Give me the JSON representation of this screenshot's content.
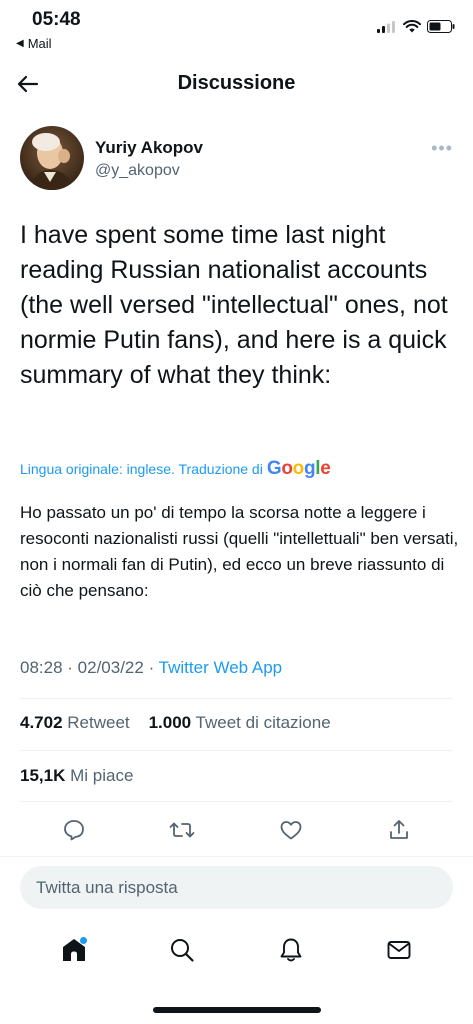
{
  "status_bar": {
    "time": "05:48",
    "back_label": "Mail",
    "icons": [
      "cellular-signal-icon",
      "wifi-icon",
      "battery-icon"
    ]
  },
  "header": {
    "title": "Discussione",
    "back_icon": "arrow-left-icon"
  },
  "tweet": {
    "author_name": "Yuriy Akopov",
    "author_handle": "@y_akopov",
    "text": "I have spent some time last night reading Russian nationalist accounts (the well versed \"intellectual\" ones, not normie Putin fans), and here is a quick summary of what they think:",
    "translation_notice": "Lingua originale: inglese. Traduzione di",
    "translation_provider": "Google",
    "translated_text": "Ho passato un po' di tempo la scorsa notte a leggere i resoconti nazionalisti russi (quelli \"intellettuali\" ben versati, non i normali fan di Putin), ed ecco un breve riassunto di ciò che pensano:",
    "time": "08:28",
    "date": "02/03/22",
    "source": "Twitter Web App"
  },
  "stats": {
    "retweets_count": "4.702",
    "retweets_label": "Retweet",
    "quotes_count": "1.000",
    "quotes_label": "Tweet di citazione",
    "likes_count": "15,1K",
    "likes_label": "Mi piace"
  },
  "actions": [
    "reply-icon",
    "retweet-icon",
    "like-icon",
    "share-icon"
  ],
  "reply": {
    "placeholder": "Twitta una risposta"
  },
  "tabbar": [
    "home-icon",
    "search-icon",
    "notifications-icon",
    "messages-icon"
  ],
  "colors": {
    "accent": "#1d9bf0",
    "text": "#0f1419",
    "secondary_text": "#536471",
    "divider": "#eff3f4"
  }
}
